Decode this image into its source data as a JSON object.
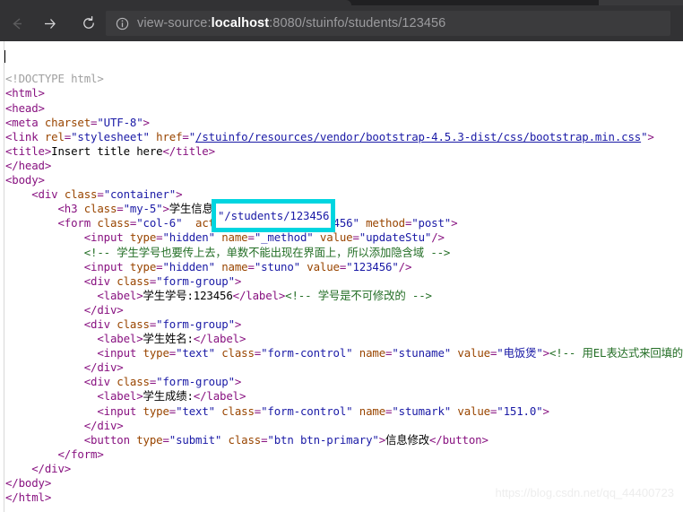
{
  "browser": {
    "back_label": "Back",
    "forward_label": "Forward",
    "reload_label": "Reload",
    "site_info_label": "View site information",
    "url": {
      "scheme": "view-source:",
      "host": "localhost",
      "rest": ":8080/stuinfo/students/123456",
      "full": "view-source:localhost:8080/stuinfo/students/123456"
    }
  },
  "source": {
    "lines": [
      {
        "id": "l01",
        "html": "<span class=\"t-doctype\">&lt;!DOCTYPE html&gt;</span>"
      },
      {
        "id": "l02",
        "html": "<span class=\"t-tag\">&lt;html&gt;</span>"
      },
      {
        "id": "l03",
        "html": "<span class=\"t-tag\">&lt;head&gt;</span>"
      },
      {
        "id": "l04",
        "html": "<span class=\"t-tag\">&lt;meta </span><span class=\"t-attr\">charset</span><span class=\"t-tag\">=</span><span class=\"t-val\">\"UTF-8\"</span><span class=\"t-tag\">&gt;</span>"
      },
      {
        "id": "l05",
        "html": "<span class=\"t-tag\">&lt;link </span><span class=\"t-attr\">rel</span><span class=\"t-tag\">=</span><span class=\"t-val\">\"stylesheet\"</span><span class=\"t-attr\"> href</span><span class=\"t-tag\">=</span><span class=\"t-val\">\"</span><span class=\"t-link\">/stuinfo/resources/vendor/bootstrap-4.5.3-dist/css/bootstrap.min.css</span><span class=\"t-val\">\"</span><span class=\"t-tag\">&gt;</span>"
      },
      {
        "id": "l06",
        "html": "<span class=\"t-tag\">&lt;title&gt;</span><span class=\"t-text\">Insert title here</span><span class=\"t-tag\">&lt;/title&gt;</span>"
      },
      {
        "id": "l07",
        "html": "<span class=\"t-tag\">&lt;/head&gt;</span>"
      },
      {
        "id": "l08",
        "html": "<span class=\"t-tag\">&lt;body&gt;</span>"
      },
      {
        "id": "l09",
        "html": "    <span class=\"t-tag\">&lt;div </span><span class=\"t-attr\">class</span><span class=\"t-tag\">=</span><span class=\"t-val\">\"container\"</span><span class=\"t-tag\">&gt;</span>"
      },
      {
        "id": "l10",
        "html": "        <span class=\"t-tag\">&lt;h3 </span><span class=\"t-attr\">class</span><span class=\"t-tag\">=</span><span class=\"t-val\">\"my-5\"</span><span class=\"t-tag\">&gt;</span><span class=\"t-text\">学生信息修改</span><span class=\"t-tag\">&lt;/h3&gt;</span>"
      },
      {
        "id": "l11",
        "html": "        <span class=\"t-tag\">&lt;form </span><span class=\"t-attr\">class</span><span class=\"t-tag\">=</span><span class=\"t-val\">\"col-6\"</span><span class=\"t-attr\">  action</span><span class=\"t-tag\">=</span><span class=\"t-val\">\"/students/123456\"</span><span class=\"t-attr\"> method</span><span class=\"t-tag\">=</span><span class=\"t-val\">\"post\"</span><span class=\"t-tag\">&gt;</span>"
      },
      {
        "id": "l12",
        "html": "            <span class=\"t-tag\">&lt;input </span><span class=\"t-attr\">type</span><span class=\"t-tag\">=</span><span class=\"t-val\">\"hidden\"</span><span class=\"t-attr\"> name</span><span class=\"t-tag\">=</span><span class=\"t-val\">\"_method\"</span><span class=\"t-attr\"> value</span><span class=\"t-tag\">=</span><span class=\"t-val\">\"updateStu\"</span><span class=\"t-tag\">/&gt;</span>"
      },
      {
        "id": "l13",
        "html": "            <span class=\"t-comment\">&lt;!-- 学生学号也要传上去，单数不能出现在界面上，所以添加隐含域 --&gt;</span>"
      },
      {
        "id": "l14",
        "html": "            <span class=\"t-tag\">&lt;input </span><span class=\"t-attr\">type</span><span class=\"t-tag\">=</span><span class=\"t-val\">\"hidden\"</span><span class=\"t-attr\"> name</span><span class=\"t-tag\">=</span><span class=\"t-val\">\"stuno\"</span><span class=\"t-attr\"> value</span><span class=\"t-tag\">=</span><span class=\"t-val\">\"123456\"</span><span class=\"t-tag\">/&gt;</span>"
      },
      {
        "id": "l15",
        "html": "            <span class=\"t-tag\">&lt;div </span><span class=\"t-attr\">class</span><span class=\"t-tag\">=</span><span class=\"t-val\">\"form-group\"</span><span class=\"t-tag\">&gt;</span>"
      },
      {
        "id": "l16",
        "html": "              <span class=\"t-tag\">&lt;label&gt;</span><span class=\"t-text\">学生学号:123456</span><span class=\"t-tag\">&lt;/label&gt;</span><span class=\"t-comment\">&lt;!-- 学号是不可修改的 --&gt;</span>"
      },
      {
        "id": "l17",
        "html": "            <span class=\"t-tag\">&lt;/div&gt;</span>"
      },
      {
        "id": "l18",
        "html": "            <span class=\"t-tag\">&lt;div </span><span class=\"t-attr\">class</span><span class=\"t-tag\">=</span><span class=\"t-val\">\"form-group\"</span><span class=\"t-tag\">&gt;</span>"
      },
      {
        "id": "l19",
        "html": "              <span class=\"t-tag\">&lt;label&gt;</span><span class=\"t-text\">学生姓名:</span><span class=\"t-tag\">&lt;/label&gt;</span>"
      },
      {
        "id": "l20",
        "html": "              <span class=\"t-tag\">&lt;input </span><span class=\"t-attr\">type</span><span class=\"t-tag\">=</span><span class=\"t-val\">\"text\"</span><span class=\"t-attr\"> class</span><span class=\"t-tag\">=</span><span class=\"t-val\">\"form-control\"</span><span class=\"t-attr\"> name</span><span class=\"t-tag\">=</span><span class=\"t-val\">\"stuname\"</span><span class=\"t-attr\"> value</span><span class=\"t-tag\">=</span><span class=\"t-val\">\"电饭煲\"</span><span class=\"t-tag\">&gt;</span><span class=\"t-comment\">&lt;!-- 用EL表达式来回填的 --</span>"
      },
      {
        "id": "l21",
        "html": "            <span class=\"t-tag\">&lt;/div&gt;</span>"
      },
      {
        "id": "l22",
        "html": "            <span class=\"t-tag\">&lt;div </span><span class=\"t-attr\">class</span><span class=\"t-tag\">=</span><span class=\"t-val\">\"form-group\"</span><span class=\"t-tag\">&gt;</span>"
      },
      {
        "id": "l23",
        "html": "              <span class=\"t-tag\">&lt;label&gt;</span><span class=\"t-text\">学生成绩:</span><span class=\"t-tag\">&lt;/label&gt;</span>"
      },
      {
        "id": "l24",
        "html": "              <span class=\"t-tag\">&lt;input </span><span class=\"t-attr\">type</span><span class=\"t-tag\">=</span><span class=\"t-val\">\"text\"</span><span class=\"t-attr\"> class</span><span class=\"t-tag\">=</span><span class=\"t-val\">\"form-control\"</span><span class=\"t-attr\"> name</span><span class=\"t-tag\">=</span><span class=\"t-val\">\"stumark\"</span><span class=\"t-attr\"> value</span><span class=\"t-tag\">=</span><span class=\"t-val\">\"151.0\"</span><span class=\"t-tag\">&gt;</span>"
      },
      {
        "id": "l25",
        "html": "            <span class=\"t-tag\">&lt;/div&gt;</span>"
      },
      {
        "id": "l26",
        "html": "            <span class=\"t-tag\">&lt;button </span><span class=\"t-attr\">type</span><span class=\"t-tag\">=</span><span class=\"t-val\">\"submit\"</span><span class=\"t-attr\"> class</span><span class=\"t-tag\">=</span><span class=\"t-val\">\"btn btn-primary\"</span><span class=\"t-tag\">&gt;</span><span class=\"t-text\">信息修改</span><span class=\"t-tag\">&lt;/button&gt;</span>"
      },
      {
        "id": "l27",
        "html": "        <span class=\"t-tag\">&lt;/form&gt;</span>"
      },
      {
        "id": "l28",
        "html": "    <span class=\"t-tag\">&lt;/div&gt;</span>"
      },
      {
        "id": "l29",
        "html": "<span class=\"t-tag\">&lt;/body&gt;</span>"
      },
      {
        "id": "l30",
        "html": "<span class=\"t-tag\">&lt;/html&gt;</span>"
      }
    ]
  },
  "annotation": {
    "highlight_text": "\"/students/123456\"",
    "highlight_color": "#00d5e0"
  },
  "watermark": {
    "text": "https://blog.csdn.net/qq_44400723"
  }
}
